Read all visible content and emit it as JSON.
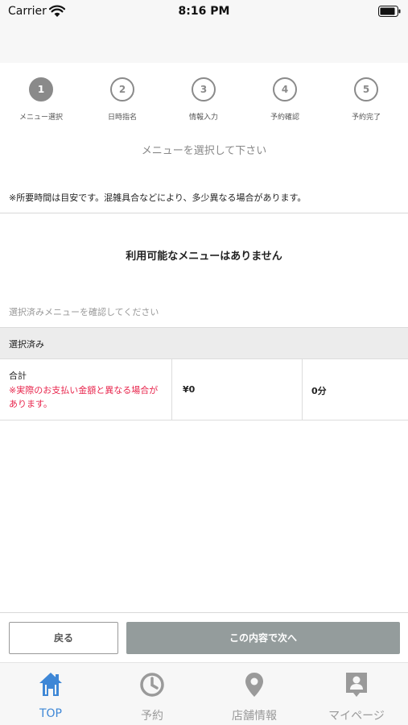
{
  "status_bar": {
    "carrier": "Carrier",
    "time": "8:16 PM"
  },
  "steps": [
    {
      "number": "1",
      "label": "メニュー選択",
      "active": true
    },
    {
      "number": "2",
      "label": "日時指名",
      "active": false
    },
    {
      "number": "3",
      "label": "情報入力",
      "active": false
    },
    {
      "number": "4",
      "label": "予約確認",
      "active": false
    },
    {
      "number": "5",
      "label": "予約完了",
      "active": false
    }
  ],
  "instruction": "メニューを選択して下さい",
  "time_note": "※所要時間は目安です。混雑具合などにより、多少異なる場合があります。",
  "no_menu_message": "利用可能なメニューはありません",
  "confirm_hint": "選択済みメニューを確認してください",
  "selected_section": {
    "header": "選択済み",
    "total_label": "合計",
    "warning": "※実際のお支払い金額と異なる場合があります。",
    "price": "¥0",
    "duration": "0分"
  },
  "buttons": {
    "back": "戻る",
    "next": "この内容で次へ"
  },
  "tab_bar": [
    {
      "label": "TOP",
      "icon": "home-icon",
      "active": true
    },
    {
      "label": "予約",
      "icon": "clock-icon",
      "active": false
    },
    {
      "label": "店舗情報",
      "icon": "location-pin-icon",
      "active": false
    },
    {
      "label": "マイページ",
      "icon": "profile-card-icon",
      "active": false
    }
  ],
  "colors": {
    "accent": "#3e87d6",
    "warning": "#e8264d",
    "next_button": "#949c9c",
    "step_gray": "#8a8a8a"
  }
}
